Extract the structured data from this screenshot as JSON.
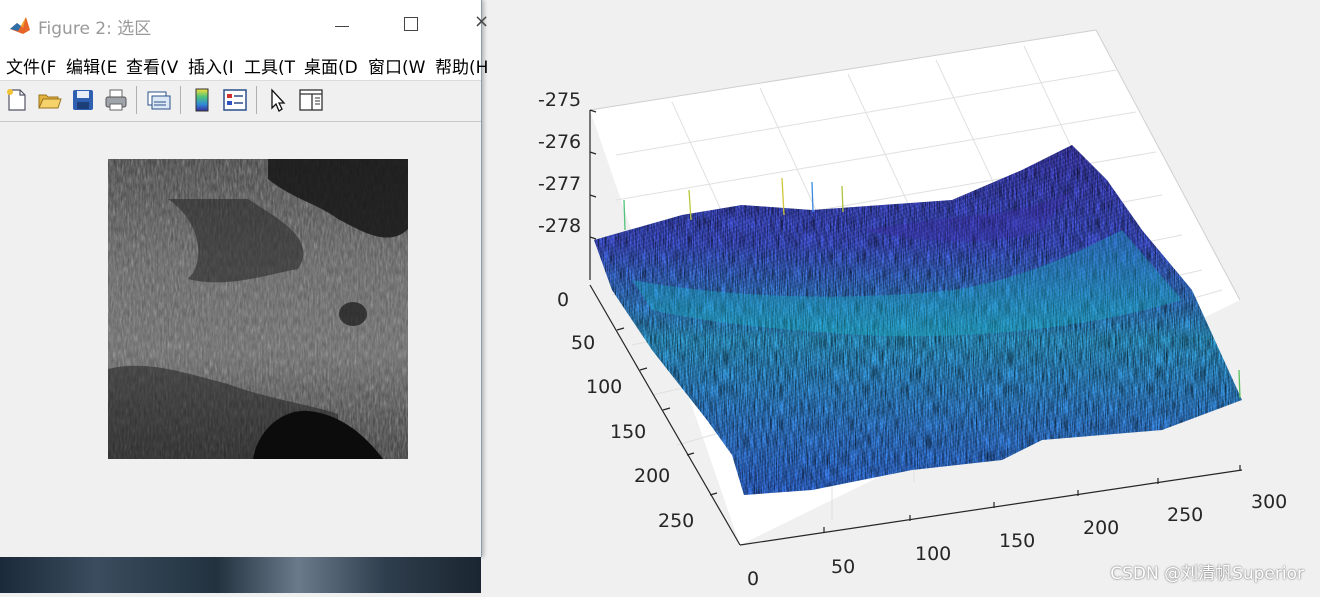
{
  "window": {
    "title": "Figure 2: 选区",
    "icon": "matlab-logo-icon",
    "controls": {
      "minimize": "minimize-icon",
      "maximize": "maximize-icon",
      "close": "×"
    }
  },
  "menu": [
    "文件(F",
    "编辑(E",
    "查看(V",
    "插入(I",
    "工具(T",
    "桌面(D",
    "窗口(W",
    "帮助(H"
  ],
  "toolbar": [
    "new-figure-icon",
    "open-file-icon",
    "save-icon",
    "print-icon",
    "link-plot-icon",
    "colorbar-icon",
    "legend-icon",
    "select-pointer-icon",
    "property-inspector-icon"
  ],
  "image_panel": {
    "description_icon": "grayscale-image"
  },
  "chart_data": {
    "type": "surface",
    "xlim": [
      0,
      300
    ],
    "ylim": [
      0,
      300
    ],
    "zlim": [
      -278,
      -275
    ],
    "xticks": [
      "0",
      "50",
      "100",
      "150",
      "200",
      "250",
      "300"
    ],
    "yticks": [
      "0",
      "50",
      "100",
      "150",
      "200",
      "250"
    ],
    "zticks": [
      "-275",
      "-276",
      "-277",
      "-278"
    ],
    "grid": true,
    "colormap": "parula"
  },
  "watermark": "CSDN @刘清帆Superior"
}
